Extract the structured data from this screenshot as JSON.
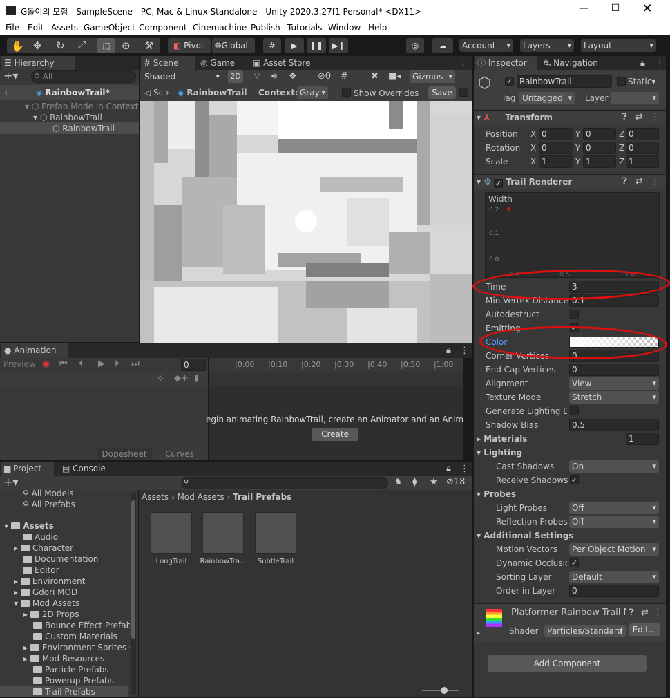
{
  "window": {
    "title": "G돌이의 모험 - SampleScene - PC, Mac & Linux Standalone - Unity 2020.3.27f1 Personal* <DX11>"
  },
  "menu": [
    "File",
    "Edit",
    "Assets",
    "GameObject",
    "Component",
    "Cinemachine",
    "Publish",
    "Tutorials",
    "Window",
    "Help"
  ],
  "toolbar": {
    "pivot": "Pivot",
    "global": "Global",
    "account": "Account",
    "layers": "Layers",
    "layout": "Layout"
  },
  "hierarchy": {
    "tab": "Hierarchy",
    "search_placeholder": "All",
    "prefab_title": "RainbowTrail*",
    "items": [
      {
        "label": "Prefab Mode in Context"
      },
      {
        "label": "RainbowTrail"
      },
      {
        "label": "RainbowTrail"
      }
    ]
  },
  "scene": {
    "tabs": {
      "scene": "Scene",
      "game": "Game",
      "asset_store": "Asset Store"
    },
    "shading": "Shaded",
    "mode_2d": "2D",
    "hidden_count": "0",
    "gizmos": "Gizmos",
    "breadcrumb_sc": "Sc",
    "breadcrumb_prefab": "RainbowTrail",
    "context_label": "Context:",
    "context_value": "Gray",
    "show_overrides": "Show Overrides",
    "save": "Save"
  },
  "animation": {
    "tab": "Animation",
    "preview": "Preview",
    "frame": "0",
    "ticks": [
      "0:00",
      "0:10",
      "0:20",
      "0:30",
      "0:40",
      "0:50",
      "1:00"
    ],
    "message": "egin animating RainbowTrail, create an Animator and an Animation",
    "create": "Create",
    "dopesheet": "Dopesheet",
    "curves": "Curves"
  },
  "project": {
    "tabs": {
      "project": "Project",
      "console": "Console"
    },
    "hidden_count": "18",
    "breadcrumb": [
      "Assets",
      "Mod Assets",
      "Trail Prefabs"
    ],
    "tree": [
      {
        "label": "All Models"
      },
      {
        "label": "All Prefabs"
      },
      {
        "label": "Assets"
      },
      {
        "label": "Audio"
      },
      {
        "label": "Character"
      },
      {
        "label": "Documentation"
      },
      {
        "label": "Editor"
      },
      {
        "label": "Environment"
      },
      {
        "label": "Gdori MOD"
      },
      {
        "label": "Mod Assets"
      },
      {
        "label": "2D Props"
      },
      {
        "label": "Bounce Effect Prefabs"
      },
      {
        "label": "Custom Materials"
      },
      {
        "label": "Environment Sprites C"
      },
      {
        "label": "Mod Resources"
      },
      {
        "label": "Particle Prefabs"
      },
      {
        "label": "Powerup Prefabs"
      },
      {
        "label": "Trail Prefabs"
      }
    ],
    "assets": [
      {
        "label": "LongTrail"
      },
      {
        "label": "RainbowTra..."
      },
      {
        "label": "SubtleTrail"
      }
    ],
    "zoom_level": 0.6
  },
  "inspector": {
    "tabs": {
      "inspector": "Inspector",
      "navigation": "Navigation"
    },
    "object_name": "RainbowTrail",
    "static": "Static",
    "tag_label": "Tag",
    "tag_value": "Untagged",
    "layer_label": "Layer",
    "layer_value": "",
    "transform": {
      "title": "Transform",
      "position": {
        "label": "Position",
        "x": "0",
        "y": "0",
        "z": "0"
      },
      "rotation": {
        "label": "Rotation",
        "x": "0",
        "y": "0",
        "z": "0"
      },
      "scale": {
        "label": "Scale",
        "x": "1",
        "y": "1",
        "z": "1"
      },
      "axis": {
        "x": "X",
        "y": "Y",
        "z": "Z"
      }
    },
    "trail": {
      "title": "Trail Renderer",
      "width_label": "Width",
      "curve_ticks_y": [
        "0.2",
        "0.1",
        "0.0"
      ],
      "curve_ticks_x": [
        "0.0",
        "0.5",
        "1.0"
      ],
      "time_label": "Time",
      "time": "3",
      "min_vertex_label": "Min Vertex Distance",
      "min_vertex": "0.1",
      "autodestruct_label": "Autodestruct",
      "emitting_label": "Emitting",
      "color_label": "Color",
      "corner_label": "Corner Vertices",
      "corner": "0",
      "endcap_label": "End Cap Vertices",
      "endcap": "0",
      "alignment_label": "Alignment",
      "alignment": "View",
      "texture_mode_label": "Texture Mode",
      "texture_mode": "Stretch",
      "gen_light_label": "Generate Lighting Da",
      "shadow_bias_label": "Shadow Bias",
      "shadow_bias": "0.5",
      "materials_label": "Materials",
      "materials": "1",
      "lighting_label": "Lighting",
      "cast_shadows_label": "Cast Shadows",
      "cast_shadows": "On",
      "receive_shadows_label": "Receive Shadows",
      "probes_label": "Probes",
      "light_probes_label": "Light Probes",
      "light_probes": "Off",
      "reflection_probes_label": "Reflection Probes",
      "reflection_probes": "Off",
      "additional_label": "Additional Settings",
      "motion_vectors_label": "Motion Vectors",
      "motion_vectors": "Per Object Motion",
      "dynamic_occlusion_label": "Dynamic Occlusion",
      "sorting_layer_label": "Sorting Layer",
      "sorting_layer": "Default",
      "order_label": "Order in Layer",
      "order": "0"
    },
    "material": {
      "name": "Platformer Rainbow Trail M",
      "shader_label": "Shader",
      "shader": "Particles/Standard",
      "edit": "Edit..."
    },
    "add_component": "Add Component"
  },
  "colors": {
    "annotation": "#dd1010",
    "curve": "#c21a1a",
    "link": "#4a8cff"
  }
}
